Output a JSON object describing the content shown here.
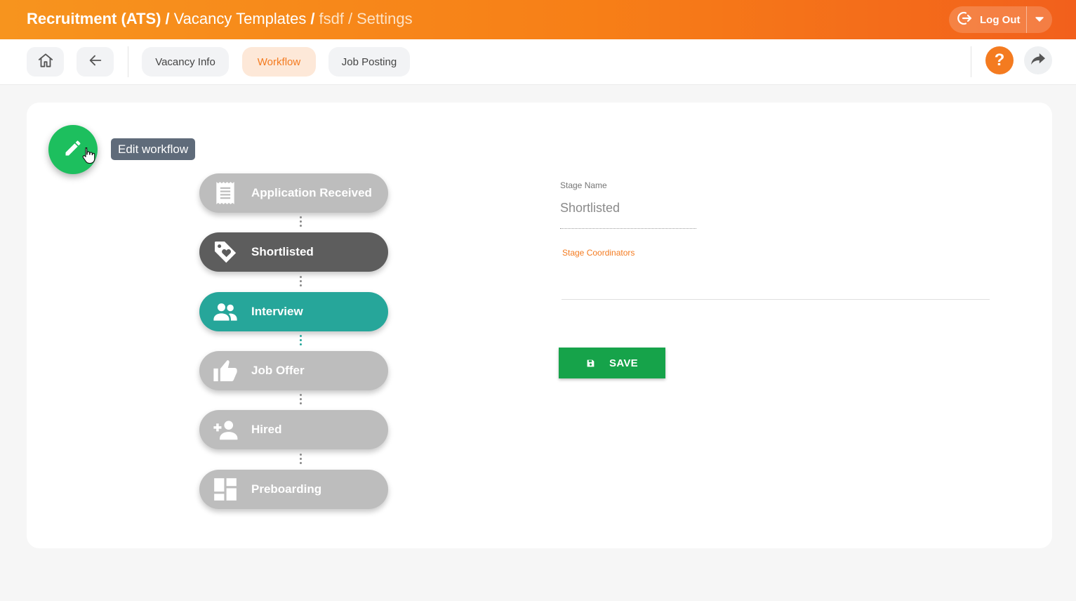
{
  "header": {
    "breadcrumb": {
      "module": "Recruitment (ATS)",
      "section": "Vacancy Templates",
      "item": "fsdf",
      "page": "Settings"
    },
    "logout_label": "Log Out"
  },
  "toolbar": {
    "tabs": [
      {
        "label": "Vacancy Info",
        "active": false
      },
      {
        "label": "Workflow",
        "active": true
      },
      {
        "label": "Job Posting",
        "active": false
      }
    ],
    "help_label": "?"
  },
  "workflow": {
    "edit_tooltip": "Edit workflow",
    "stages": [
      {
        "label": "Application Received",
        "icon": "receipt-icon",
        "state": "default"
      },
      {
        "label": "Shortlisted",
        "icon": "tag-heart-icon",
        "state": "selected"
      },
      {
        "label": "Interview",
        "icon": "people-icon",
        "state": "active"
      },
      {
        "label": "Job Offer",
        "icon": "thumbs-up-icon",
        "state": "default"
      },
      {
        "label": "Hired",
        "icon": "person-add-icon",
        "state": "default"
      },
      {
        "label": "Preboarding",
        "icon": "dashboard-icon",
        "state": "default"
      }
    ]
  },
  "form": {
    "stage_name_label": "Stage Name",
    "stage_name_value": "Shortlisted",
    "stage_coordinators_label": "Stage Coordinators",
    "save_label": "SAVE"
  },
  "colors": {
    "accent_orange": "#f47b20",
    "header_gradient_start": "#f7941e",
    "header_gradient_end": "#f2601c",
    "fab_green": "#1dbf5e",
    "save_green": "#16a34a",
    "stage_active_teal": "#26a69a",
    "stage_selected": "#5d5d5d",
    "stage_default": "#bdbdbd"
  }
}
